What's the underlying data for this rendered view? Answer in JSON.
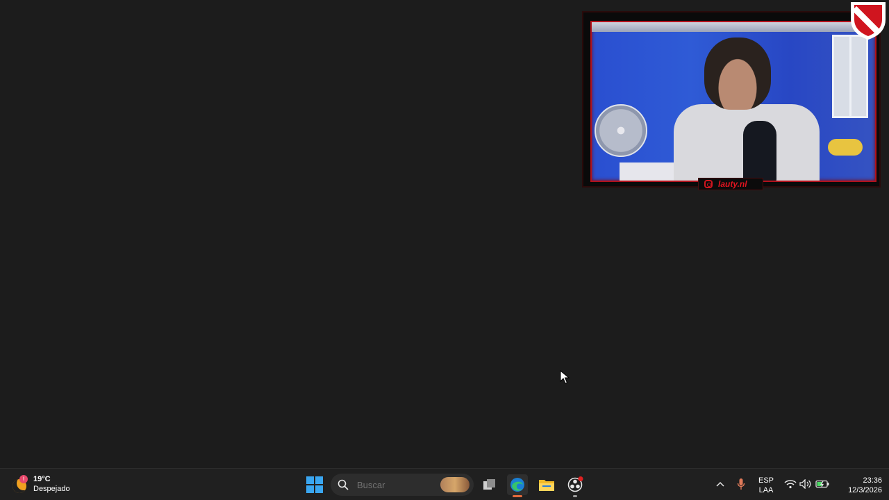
{
  "webcam": {
    "handle": "lauty.nl"
  },
  "logo": {
    "text": "CAI"
  },
  "taskbar": {
    "weather": {
      "temperature": "19°C",
      "condition": "Despejado",
      "alert_badge": "!"
    },
    "search": {
      "placeholder": "Buscar"
    },
    "pinned": [
      {
        "name": "start",
        "icon": "windows-logo-icon"
      },
      {
        "name": "task-view",
        "icon": "task-view-icon"
      },
      {
        "name": "edge",
        "icon": "edge-icon",
        "active": true
      },
      {
        "name": "file-explorer",
        "icon": "folder-icon"
      },
      {
        "name": "obs",
        "icon": "obs-icon",
        "recording": true
      }
    ],
    "tray": {
      "language": "ESP",
      "layout": "LAA",
      "time": "23:36",
      "date": "12/3/2026"
    }
  },
  "colors": {
    "accent_red": "#d0151f",
    "taskbar_bg": "#202020",
    "desktop_bg": "#1c1c1c"
  }
}
